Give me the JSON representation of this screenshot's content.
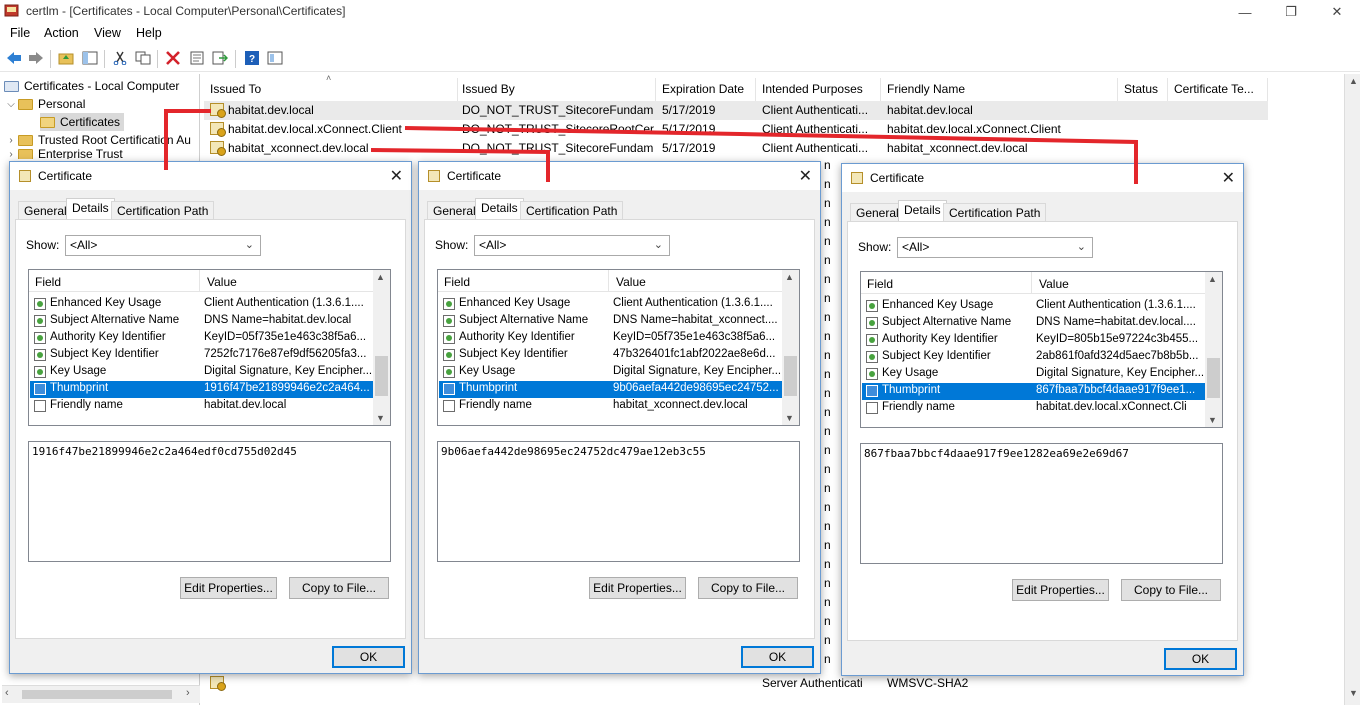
{
  "window": {
    "title": "certlm - [Certificates - Local Computer\\Personal\\Certificates]"
  },
  "menu": [
    "File",
    "Action",
    "View",
    "Help"
  ],
  "toolbar_icons": [
    "back-arrow-icon",
    "forward-arrow-icon",
    "up-folder-icon",
    "show-hide-tree-icon",
    "cut-icon",
    "copy-icon",
    "delete-icon",
    "properties-icon",
    "export-icon",
    "help-icon",
    "view-icon"
  ],
  "tree": {
    "root": "Certificates - Local Computer",
    "personal": "Personal",
    "certificates": "Certificates",
    "trusted_root": "Trusted Root Certification Au",
    "enterprise": "Enterprise Trust"
  },
  "list": {
    "columns": [
      "Issued To",
      "Issued By",
      "Expiration Date",
      "Intended Purposes",
      "Friendly Name",
      "Status",
      "Certificate Te..."
    ],
    "rows": [
      {
        "issued_to": "habitat.dev.local",
        "issued_by": "DO_NOT_TRUST_SitecoreFundam...",
        "expires": "5/17/2019",
        "purposes": "Client Authenticati...",
        "friendly": "habitat.dev.local"
      },
      {
        "issued_to": "habitat.dev.local.xConnect.Client",
        "issued_by": "DO_NOT_TRUST_SitecoreRootCert",
        "expires": "5/17/2019",
        "purposes": "Client Authenticati...",
        "friendly": "habitat.dev.local.xConnect.Client"
      },
      {
        "issued_to": "habitat_xconnect.dev.local",
        "issued_by": "DO_NOT_TRUST_SitecoreFundam...",
        "expires": "5/17/2019",
        "purposes": "Client Authenticati...",
        "friendly": "habitat_xconnect.dev.local"
      }
    ],
    "bottom_row": {
      "purposes": "Server Authenticati",
      "friendly": "WMSVC-SHA2"
    },
    "partial_purposes": [
      "n",
      "n",
      "n",
      "n",
      "n",
      "n",
      "n",
      "n",
      "n",
      "n",
      "n",
      "n",
      "n",
      "n",
      "n",
      "n",
      "n",
      "n",
      "n",
      "n",
      "n",
      "n",
      "n",
      "n",
      "n",
      "n",
      "n"
    ]
  },
  "dialog_common": {
    "title": "Certificate",
    "tabs": [
      "General",
      "Details",
      "Certification Path"
    ],
    "show_label": "Show:",
    "show_value": "<All>",
    "field_header": "Field",
    "value_header": "Value",
    "fields": [
      "Enhanced Key Usage",
      "Subject Alternative Name",
      "Authority Key Identifier",
      "Subject Key Identifier",
      "Key Usage",
      "Thumbprint",
      "Friendly name"
    ],
    "edit_button": "Edit Properties...",
    "copy_button": "Copy to File...",
    "ok_button": "OK"
  },
  "dialogs": [
    {
      "values": [
        "Client Authentication (1.3.6.1....",
        "DNS Name=habitat.dev.local",
        "KeyID=05f735e1e463c38f5a6...",
        "7252fc7176e87ef9df56205fa3...",
        "Digital Signature, Key Encipher...",
        "1916f47be21899946e2c2a464...",
        "habitat.dev.local"
      ],
      "thumbprint": "1916f47be21899946e2c2a464edf0cd755d02d45"
    },
    {
      "values": [
        "Client Authentication (1.3.6.1....",
        "DNS Name=habitat_xconnect....",
        "KeyID=05f735e1e463c38f5a6...",
        "47b326401fc1abf2022ae8e6d...",
        "Digital Signature, Key Encipher...",
        "9b06aefa442de98695ec24752...",
        "habitat_xconnect.dev.local"
      ],
      "thumbprint": "9b06aefa442de98695ec24752dc479ae12eb3c55"
    },
    {
      "values": [
        "Client Authentication (1.3.6.1....",
        "DNS Name=habitat.dev.local....",
        "KeyID=805b15e97224c3b455...",
        "2ab861f0afd324d5aec7b8b5b...",
        "Digital Signature, Key Encipher...",
        "867fbaa7bbcf4daae917f9ee1...",
        "habitat.dev.local.xConnect.Cli"
      ],
      "thumbprint": "867fbaa7bbcf4daae917f9ee1282ea69e2e69d67"
    }
  ],
  "colors": {
    "selection": "#0078d7",
    "annotation": "#e3262b",
    "dialog_border": "#6b9bd1"
  }
}
